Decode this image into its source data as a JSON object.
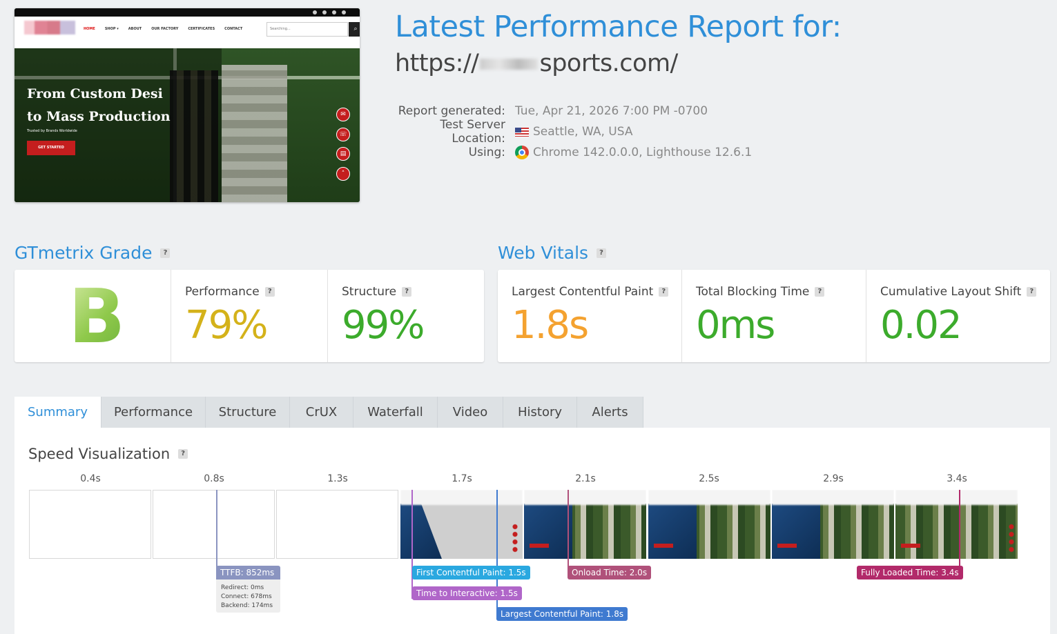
{
  "thumbnail": {
    "nav_links": [
      "HOME",
      "SHOP ▾",
      "ABOUT",
      "OUR FACTORY",
      "CERTIFICATES",
      "CONTACT"
    ],
    "search_placeholder": "Searching...",
    "hero_line1": "From Custom Desi",
    "hero_line2": "to Mass Production",
    "hero_sub": "Trusted by Brands Worldwide",
    "hero_button": "GET STARTED"
  },
  "header": {
    "title": "Latest Performance Report for:",
    "url_prefix": "https://",
    "url_suffix": "sports.com/",
    "report_generated_label": "Report generated:",
    "report_generated_value": "Tue, Apr 21, 2026 7:00 PM -0700",
    "location_label": "Test Server Location:",
    "location_value": "Seattle, WA, USA",
    "using_label": "Using:",
    "using_value": "Chrome 142.0.0.0, Lighthouse 12.6.1"
  },
  "grade": {
    "heading": "GTmetrix Grade",
    "help": "?",
    "letter": "B",
    "performance_label": "Performance",
    "performance_value": "79%",
    "structure_label": "Structure",
    "structure_value": "99%",
    "colors": {
      "performance": "#d4b21a",
      "structure": "#3cab2c"
    }
  },
  "vitals": {
    "heading": "Web Vitals",
    "lcp_label": "Largest Contentful Paint",
    "lcp_value": "1.8s",
    "tbt_label": "Total Blocking Time",
    "tbt_value": "0ms",
    "cls_label": "Cumulative Layout Shift",
    "cls_value": "0.02",
    "colors": {
      "lcp": "#f4a230",
      "tbt": "#3cab2c",
      "cls": "#3cab2c"
    }
  },
  "tabs": [
    "Summary",
    "Performance",
    "Structure",
    "CrUX",
    "Waterfall",
    "Video",
    "History",
    "Alerts"
  ],
  "active_tab": "Summary",
  "speed_viz": {
    "title": "Speed Visualization",
    "ticks": [
      "0.4s",
      "0.8s",
      "1.3s",
      "1.7s",
      "2.1s",
      "2.5s",
      "2.9s",
      "3.4s"
    ],
    "markers": {
      "ttfb": "TTFB: 852ms",
      "fcp": "First Contentful Paint: 1.5s",
      "tti": "Time to Interactive: 1.5s",
      "lcp": "Largest Contentful Paint: 1.8s",
      "onload": "Onload Time: 2.0s",
      "fully_loaded": "Fully Loaded Time: 3.4s"
    },
    "ttfb_details": {
      "redirect": "Redirect: 0ms",
      "connect": "Connect: 678ms",
      "backend": "Backend: 174ms"
    },
    "marker_colors": {
      "ttfb": "#8a94c0",
      "fcp": "#2aa8e0",
      "tti": "#b066c9",
      "lcp": "#3f7ad0",
      "onload": "#b0517a",
      "fully_loaded": "#b22a6a"
    }
  }
}
